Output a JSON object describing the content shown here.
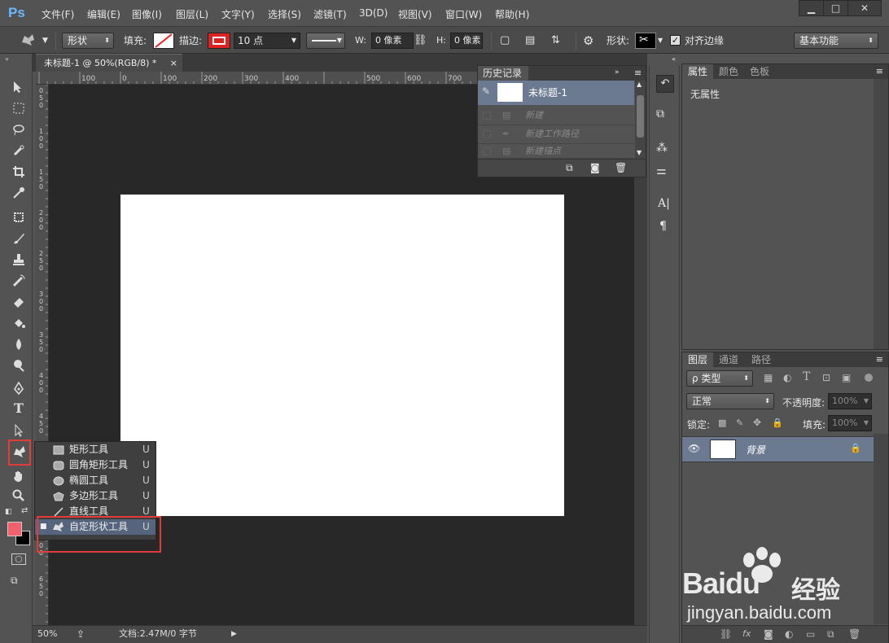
{
  "app": {
    "logo": "Ps"
  },
  "menu": [
    "文件(F)",
    "编辑(E)",
    "图像(I)",
    "图层(L)",
    "文字(Y)",
    "选择(S)",
    "滤镜(T)",
    "3D(D)",
    "视图(V)",
    "窗口(W)",
    "帮助(H)"
  ],
  "window_controls": {
    "minimize": "▁",
    "maximize": "□",
    "close": "✕"
  },
  "options": {
    "mode": "形状",
    "fill_label": "填充:",
    "stroke_label": "描边:",
    "stroke_size": "10 点",
    "w_label": "W:",
    "w_value": "0 像素",
    "h_label": "H:",
    "h_value": "0 像素",
    "shape_label": "形状:",
    "align_edges": "对齐边缘",
    "workspace": "基本功能"
  },
  "document": {
    "tab_title": "未标题-1 @ 50%(RGB/8) *",
    "tab_close": "×",
    "zoom": "50%",
    "doc_info": "文档:2.47M/0 字节",
    "ruler_h": [
      "100",
      "0",
      "100",
      "200",
      "300",
      "400",
      "500",
      "600",
      "700",
      "800"
    ],
    "ruler_v": [
      "0",
      "5",
      "0",
      "1",
      "0",
      "0",
      "1",
      "5",
      "0",
      "2",
      "0",
      "0",
      "2",
      "5",
      "0",
      "3",
      "0",
      "0",
      "3",
      "5",
      "0",
      "4",
      "0",
      "0",
      "4",
      "5",
      "0",
      "5",
      "0",
      "0",
      "5",
      "5",
      "0",
      "6",
      "0",
      "0",
      "6",
      "5",
      "0"
    ]
  },
  "history": {
    "tab": "历史记录",
    "snapshot": "未标题-1",
    "rows": [
      "新建",
      "新建工作路径",
      "新建锚点"
    ]
  },
  "properties": {
    "tabs": [
      "属性",
      "颜色",
      "色板"
    ],
    "body": "无属性"
  },
  "layers": {
    "tabs": [
      "图层",
      "通道",
      "路径"
    ],
    "filter": "ρ 类型",
    "blend_mode": "正常",
    "opacity_label": "不透明度:",
    "opacity_value": "100%",
    "lock_label": "锁定:",
    "fill_label": "填充:",
    "fill_value": "100%",
    "layer_name": "背景"
  },
  "flyout": [
    {
      "label": "矩形工具",
      "key": "U",
      "icon": "rectangle-icon"
    },
    {
      "label": "圆角矩形工具",
      "key": "U",
      "icon": "rounded-rectangle-icon"
    },
    {
      "label": "椭圆工具",
      "key": "U",
      "icon": "ellipse-icon"
    },
    {
      "label": "多边形工具",
      "key": "U",
      "icon": "polygon-icon"
    },
    {
      "label": "直线工具",
      "key": "U",
      "icon": "line-icon"
    },
    {
      "label": "自定形状工具",
      "key": "U",
      "icon": "custom-shape-icon",
      "selected": true
    }
  ],
  "colors": {
    "foreground": "#f2606e",
    "background": "#000000",
    "highlight": "#e33a3a",
    "selection": "#6b7a91"
  },
  "watermark": {
    "brand": "Baidu",
    "cn": "经验",
    "url": "jingyan.baidu.com"
  }
}
